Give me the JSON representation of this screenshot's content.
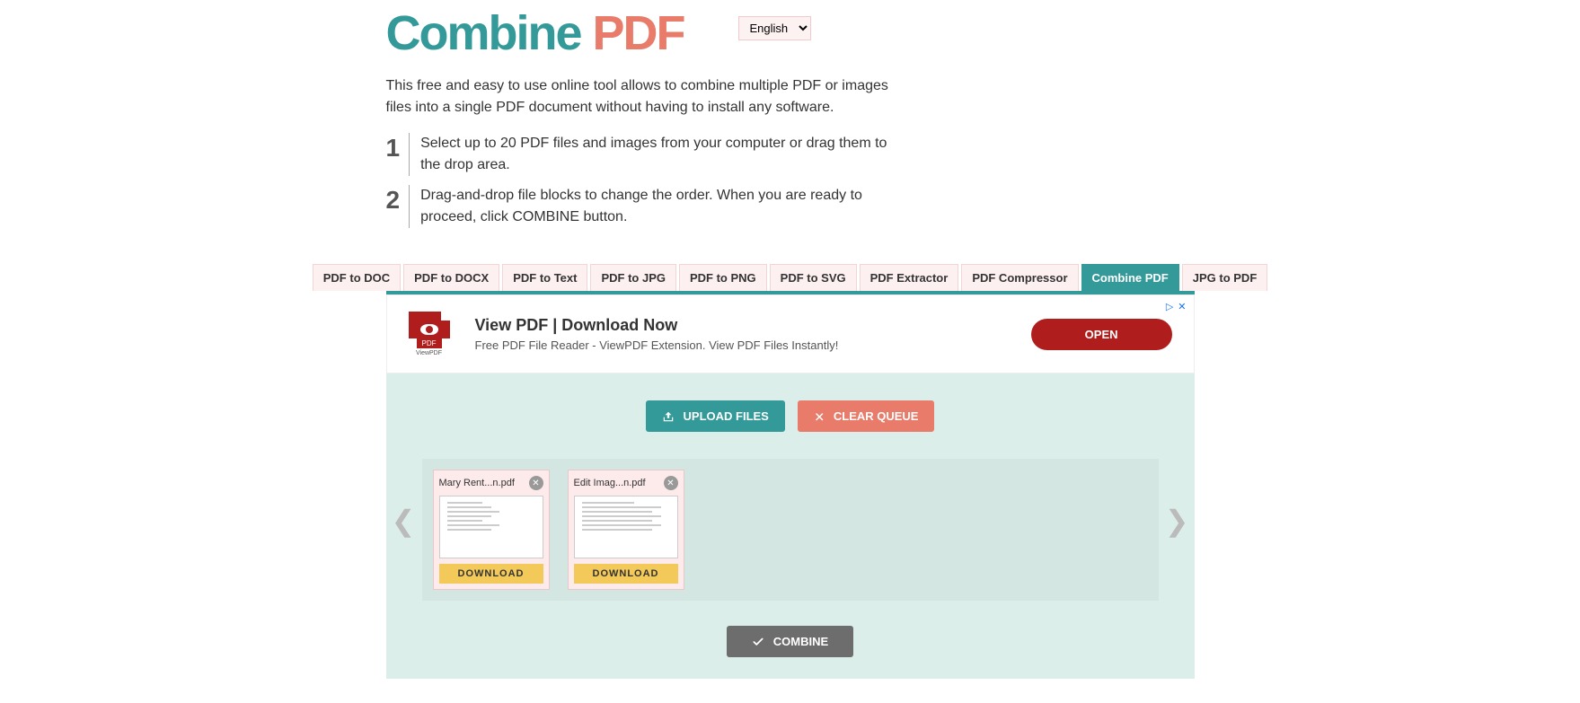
{
  "logo": {
    "part1": "Combine ",
    "part2": "PDF"
  },
  "language": {
    "selected": "English"
  },
  "intro": "This free and easy to use online tool allows to combine multiple PDF or images files into a single PDF document without having to install any software.",
  "steps": [
    {
      "num": "1",
      "text": "Select up to 20 PDF files and images from your computer or drag them to the drop area."
    },
    {
      "num": "2",
      "text": "Drag-and-drop file blocks to change the order. When you are ready to proceed, click COMBINE button."
    }
  ],
  "tabs": [
    {
      "label": "PDF to DOC",
      "active": false
    },
    {
      "label": "PDF to DOCX",
      "active": false
    },
    {
      "label": "PDF to Text",
      "active": false
    },
    {
      "label": "PDF to JPG",
      "active": false
    },
    {
      "label": "PDF to PNG",
      "active": false
    },
    {
      "label": "PDF to SVG",
      "active": false
    },
    {
      "label": "PDF Extractor",
      "active": false
    },
    {
      "label": "PDF Compressor",
      "active": false
    },
    {
      "label": "Combine PDF",
      "active": true
    },
    {
      "label": "JPG to PDF",
      "active": false
    }
  ],
  "ad": {
    "icon_label": "PDF",
    "icon_sub": "ViewPDF",
    "title": "View PDF | Download Now",
    "subtitle": "Free PDF File Reader - ViewPDF Extension. View PDF Files Instantly!",
    "button": "OPEN"
  },
  "toolbar": {
    "upload": "UPLOAD FILES",
    "clear": "CLEAR QUEUE",
    "combine": "COMBINE"
  },
  "files": [
    {
      "name": "Mary Rent...n.pdf",
      "download": "DOWNLOAD"
    },
    {
      "name": "Edit Imag...n.pdf",
      "download": "DOWNLOAD"
    }
  ],
  "nav": {
    "prev": "❮",
    "next": "❯"
  }
}
